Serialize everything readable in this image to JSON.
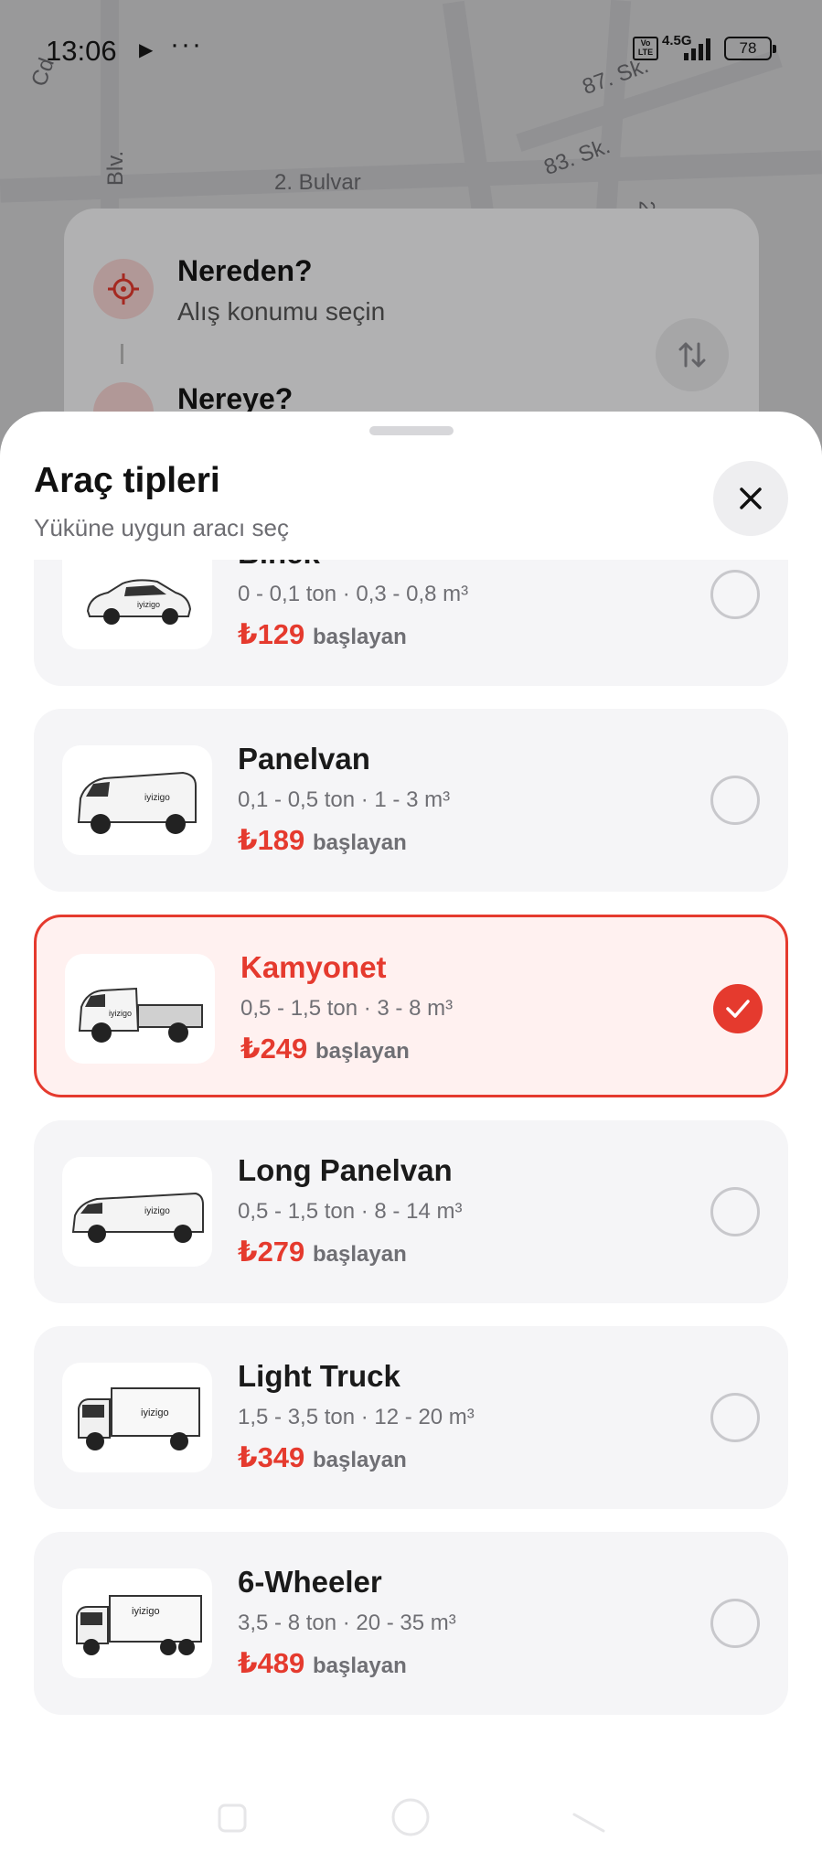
{
  "status_bar": {
    "time": "13:06",
    "network": "4.5G",
    "volte": "Vo LTE",
    "battery": "78"
  },
  "map": {
    "labels": [
      "2. Bulvar",
      "87. Sk.",
      "83. Sk.",
      "Blv.",
      "Cd.",
      "2"
    ]
  },
  "location": {
    "from_title": "Nereden?",
    "from_subtitle": "Alış konumu seçin",
    "to_title": "Nereye?"
  },
  "sheet": {
    "title": "Araç tipleri",
    "subtitle": "Yüküne uygun aracı seç"
  },
  "vehicles": [
    {
      "name": "Binek",
      "spec": "0 - 0,1 ton · 0,3 - 0,8 m³",
      "price": "₺129",
      "from_label": "başlayan",
      "selected": false
    },
    {
      "name": "Panelvan",
      "spec": "0,1 - 0,5 ton · 1 - 3 m³",
      "price": "₺189",
      "from_label": "başlayan",
      "selected": false
    },
    {
      "name": "Kamyonet",
      "spec": "0,5 - 1,5 ton · 3 - 8 m³",
      "price": "₺249",
      "from_label": "başlayan",
      "selected": true
    },
    {
      "name": "Long Panelvan",
      "spec": "0,5 - 1,5 ton · 8 - 14 m³",
      "price": "₺279",
      "from_label": "başlayan",
      "selected": false
    },
    {
      "name": "Light Truck",
      "spec": "1,5 - 3,5 ton · 12 - 20 m³",
      "price": "₺349",
      "from_label": "başlayan",
      "selected": false
    },
    {
      "name": "6-Wheeler",
      "spec": "3,5 - 8 ton · 20 - 35 m³",
      "price": "₺489",
      "from_label": "başlayan",
      "selected": false
    }
  ],
  "brand_logo_text": "iyizigo",
  "colors": {
    "accent": "#e53a2e",
    "selected_bg": "#fff1f0",
    "card_bg": "#f5f5f7"
  }
}
